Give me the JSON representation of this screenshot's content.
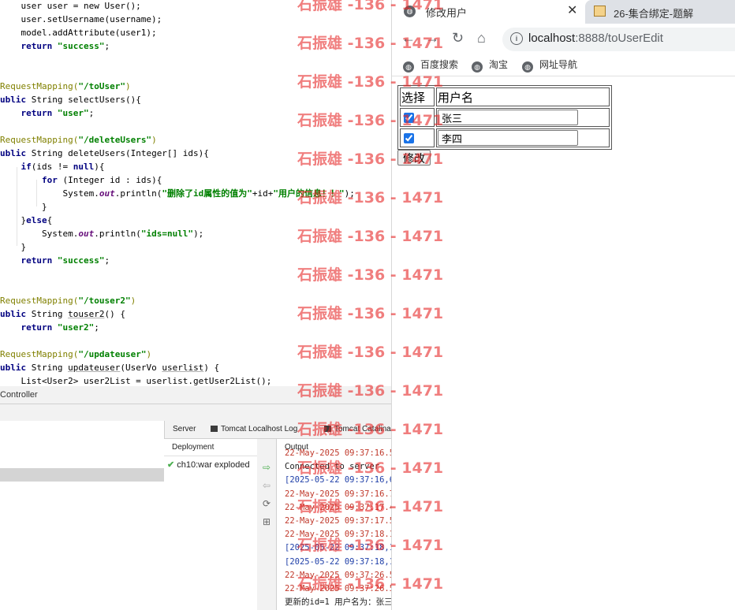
{
  "code_lines": [
    {
      "segs": [
        {
          "t": "    user user = new User();"
        }
      ]
    },
    {
      "segs": [
        {
          "t": "    user.setUsername(username);"
        }
      ]
    },
    {
      "segs": [
        {
          "t": "    model.addAttribute(user1);"
        }
      ]
    },
    {
      "segs": [
        {
          "t": "    "
        },
        {
          "t": "return",
          "c": "kw"
        },
        {
          "t": " "
        },
        {
          "t": "\"success\"",
          "c": "str"
        },
        {
          "t": ";"
        }
      ]
    },
    {
      "segs": [
        {
          "t": ""
        }
      ]
    },
    {
      "segs": [
        {
          "t": ""
        }
      ]
    },
    {
      "segs": [
        {
          "t": "RequestMapping(",
          "c": "ann"
        },
        {
          "t": "\"/toUser\"",
          "c": "str"
        },
        {
          "t": ")",
          "c": "ann"
        }
      ]
    },
    {
      "segs": [
        {
          "t": "ublic",
          "c": "kw"
        },
        {
          "t": " String selectUsers(){"
        }
      ]
    },
    {
      "segs": [
        {
          "t": "    "
        },
        {
          "t": "return",
          "c": "kw"
        },
        {
          "t": " "
        },
        {
          "t": "\"user\"",
          "c": "str"
        },
        {
          "t": ";"
        }
      ]
    },
    {
      "segs": [
        {
          "t": ""
        }
      ]
    },
    {
      "segs": [
        {
          "t": "RequestMapping(",
          "c": "ann"
        },
        {
          "t": "\"/deleteUsers\"",
          "c": "str"
        },
        {
          "t": ")",
          "c": "ann"
        }
      ]
    },
    {
      "segs": [
        {
          "t": "ublic",
          "c": "kw"
        },
        {
          "t": " String deleteUsers(Integer[] ids){"
        }
      ]
    },
    {
      "segs": [
        {
          "t": "    "
        },
        {
          "t": "if",
          "c": "kw"
        },
        {
          "t": "(ids != "
        },
        {
          "t": "null",
          "c": "kw"
        },
        {
          "t": "){"
        }
      ]
    },
    {
      "segs": [
        {
          "t": "        "
        },
        {
          "t": "for",
          "c": "kw"
        },
        {
          "t": " (Integer id : ids){"
        }
      ]
    },
    {
      "segs": [
        {
          "t": "            System."
        },
        {
          "t": "out",
          "c": "fld"
        },
        {
          "t": ".println("
        },
        {
          "t": "\"删除了id属性的值为\"",
          "c": "str"
        },
        {
          "t": "+id+"
        },
        {
          "t": "\"用户的信息！！\"",
          "c": "str"
        },
        {
          "t": ");"
        }
      ]
    },
    {
      "segs": [
        {
          "t": "        }"
        }
      ]
    },
    {
      "segs": [
        {
          "t": "    }"
        },
        {
          "t": "else",
          "c": "kw"
        },
        {
          "t": "{"
        }
      ]
    },
    {
      "segs": [
        {
          "t": "        System."
        },
        {
          "t": "out",
          "c": "fld"
        },
        {
          "t": ".println("
        },
        {
          "t": "\"ids=null\"",
          "c": "str"
        },
        {
          "t": ");"
        }
      ]
    },
    {
      "segs": [
        {
          "t": "    }"
        }
      ]
    },
    {
      "segs": [
        {
          "t": "    "
        },
        {
          "t": "return",
          "c": "kw"
        },
        {
          "t": " "
        },
        {
          "t": "\"success\"",
          "c": "str"
        },
        {
          "t": ";"
        }
      ]
    },
    {
      "segs": [
        {
          "t": ""
        }
      ]
    },
    {
      "segs": [
        {
          "t": ""
        }
      ]
    },
    {
      "segs": [
        {
          "t": "RequestMapping(",
          "c": "ann"
        },
        {
          "t": "\"/touser2\"",
          "c": "str"
        },
        {
          "t": ")",
          "c": "ann"
        }
      ]
    },
    {
      "segs": [
        {
          "t": "ublic",
          "c": "kw"
        },
        {
          "t": " String "
        },
        {
          "t": "touser2",
          "c": "ul"
        },
        {
          "t": "() {"
        }
      ]
    },
    {
      "segs": [
        {
          "t": "    "
        },
        {
          "t": "return",
          "c": "kw"
        },
        {
          "t": " "
        },
        {
          "t": "\"user2\"",
          "c": "str"
        },
        {
          "t": ";"
        }
      ]
    },
    {
      "segs": [
        {
          "t": ""
        }
      ]
    },
    {
      "segs": [
        {
          "t": "RequestMapping(",
          "c": "ann"
        },
        {
          "t": "\"/updateuser\"",
          "c": "str"
        },
        {
          "t": ")",
          "c": "ann"
        }
      ]
    },
    {
      "segs": [
        {
          "t": "ublic",
          "c": "kw"
        },
        {
          "t": " String "
        },
        {
          "t": "updateuser",
          "c": "ul"
        },
        {
          "t": "(UserVo "
        },
        {
          "t": "userlist",
          "c": "ul"
        },
        {
          "t": ") {"
        }
      ]
    },
    {
      "segs": [
        {
          "t": "    List<User2> user2List = userlist.getUser2List();"
        }
      ]
    }
  ],
  "ide": {
    "panel_title": "Controller",
    "tabs": [
      "Server",
      "Tomcat Localhost Log",
      "Tomcat Catalina"
    ],
    "deployment_header": "Deployment",
    "deployment_item": "ch10:war exploded",
    "output_header": "Output",
    "output_lines": [
      {
        "text": "22-May-2025 09:37:16.5",
        "color": "#c0392b"
      },
      {
        "text": "Connected to server",
        "color": "#222"
      },
      {
        "text": "[2025-05-22 09:37:16,6",
        "color": "#1f3fa8"
      },
      {
        "text": "22-May-2025 09:37:16.7",
        "color": "#c0392b"
      },
      {
        "text": "22-May-2025 09:37:17.4",
        "color": "#c0392b"
      },
      {
        "text": "22-May-2025 09:37:17.5",
        "color": "#c0392b"
      },
      {
        "text": "22-May-2025 09:37:18.1",
        "color": "#c0392b"
      },
      {
        "text": "[2025-05-22 09:37:18,1",
        "color": "#1f3fa8"
      },
      {
        "text": "[2025-05-22 09:37:18,1",
        "color": "#1f3fa8"
      },
      {
        "text": "22-May-2025 09:37:26.5",
        "color": "#c0392b"
      },
      {
        "text": "22-May-2025 09:37:26.5",
        "color": "#c0392b"
      },
      {
        "text": "更新的id=1 用户名为：张三",
        "color": "#222"
      }
    ]
  },
  "browser": {
    "active_tab_title": "修改用户",
    "close_glyph": "✕",
    "inactive_tab_title": "26-集合绑定-题解",
    "url_host": "localhost",
    "url_rest": ":8888/toUserEdit",
    "bookmarks": [
      "百度搜索",
      "淘宝",
      "网址导航"
    ],
    "nav": {
      "back": "←",
      "forward": "→",
      "reload": "↻",
      "home": "⌂"
    },
    "page": {
      "col_select": "选择",
      "col_username": "用户名",
      "rows": [
        {
          "checked": true,
          "name": "张三"
        },
        {
          "checked": true,
          "name": "李四"
        }
      ],
      "submit_label": "修改"
    }
  },
  "watermark": "石振雄 -136 - 1471"
}
